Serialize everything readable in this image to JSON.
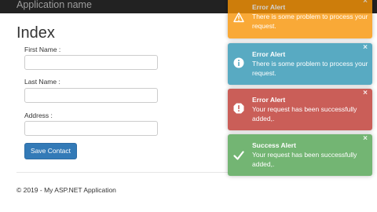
{
  "navbar": {
    "brand": "Application name"
  },
  "page": {
    "title": "Index"
  },
  "form": {
    "first_name": {
      "label": "First Name :",
      "value": ""
    },
    "last_name": {
      "label": "Last Name :",
      "value": ""
    },
    "address": {
      "label": "Address :",
      "value": ""
    },
    "save_label": "Save Contact"
  },
  "footer": {
    "text": "© 2019 - My ASP.NET Application"
  },
  "toasts": [
    {
      "kind": "warning",
      "icon": "warning-icon",
      "color": "#f89406",
      "title": "Error Alert",
      "message": "There is some problem to process your request.",
      "close": "×"
    },
    {
      "kind": "info",
      "icon": "info-icon",
      "color": "#2f96b4",
      "title": "Error Alert",
      "message": "There is some problem to process your request.",
      "close": "×"
    },
    {
      "kind": "error",
      "icon": "error-icon",
      "color": "#bd362f",
      "title": "Error Alert",
      "message": "Your request has been successfully added,.",
      "close": "×"
    },
    {
      "kind": "success",
      "icon": "checkmark-icon",
      "color": "#51a351",
      "title": "Success Alert",
      "message": "Your request has been successfully added,.",
      "close": "×"
    }
  ]
}
